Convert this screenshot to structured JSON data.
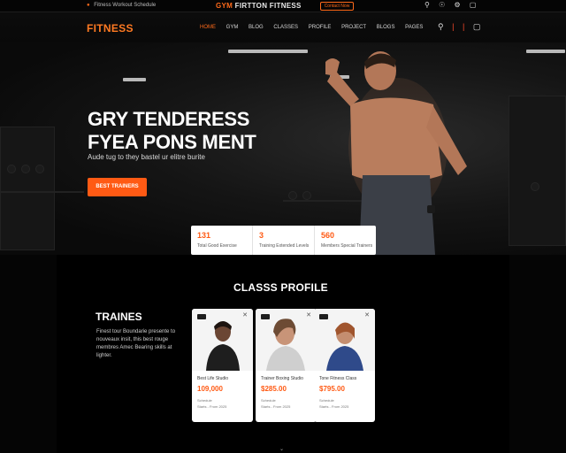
{
  "topbar": {
    "left_text": "Fitness Workout Schedule",
    "center_left": "GYM",
    "center_right": "FITNESS",
    "center_brand": "FIRTTON FITNESS",
    "cta": "Contact Now",
    "icons": [
      "search-icon",
      "user-icon",
      "settings-icon",
      "bag-icon"
    ]
  },
  "nav": {
    "logo": "FITNESS",
    "menu": [
      "HOME",
      "GYM",
      "BLOG",
      "CLASSES",
      "PROFILE",
      "PROJECT",
      "BLOGS",
      "PAGES"
    ],
    "active_index": 0
  },
  "hero": {
    "title_line1": "GRY TENDERESS",
    "title_line2": "FYEA PONS MENT",
    "subtitle": "Aude tug to they bastel ur elitre burite",
    "button": "BEST TRAINERS"
  },
  "stats": [
    {
      "value": "131",
      "label": "Total Good Exercise"
    },
    {
      "value": "3",
      "label": "Training Extended Levels"
    },
    {
      "value": "560",
      "label": "Members Special Trainers"
    }
  ],
  "classes": {
    "title": "CLASSS PROFILE"
  },
  "trainers": {
    "title": "TRAINES",
    "description": "Finest tour Boundarie presente to nouveaux insit, this best rouge membres Amec Bearing skills at lighter."
  },
  "cards": [
    {
      "name": "Best Life Studio",
      "price": "109,000",
      "meta1": "Schedule",
      "meta2": "Starts - From 2025"
    },
    {
      "name": "Trainer Boxing Studio",
      "price": "$285.00",
      "meta1": "Schedule",
      "meta2": "Starts - From 2025"
    },
    {
      "name": "Tone Fitness Class",
      "price": "$795.00",
      "meta1": "Schedule",
      "meta2": "Starts - From 2025"
    }
  ],
  "colors": {
    "accent": "#ff5a14",
    "logo": "#ff7a22",
    "background": "#0b0b0b"
  }
}
